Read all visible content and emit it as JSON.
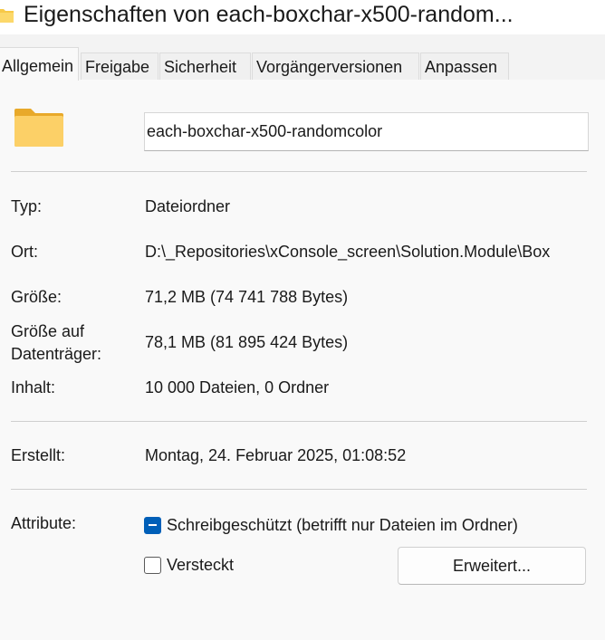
{
  "window": {
    "title": "Eigenschaften von each-boxchar-x500-random..."
  },
  "tabs": [
    {
      "label": "Allgemein",
      "active": true
    },
    {
      "label": "Freigabe",
      "active": false
    },
    {
      "label": "Sicherheit",
      "active": false
    },
    {
      "label": "Vorgängerversionen",
      "active": false
    },
    {
      "label": "Anpassen",
      "active": false
    }
  ],
  "header": {
    "folder_icon": "folder-icon",
    "folder_icon_color": "#f7c948",
    "name_value": "each-boxchar-x500-randomcolor"
  },
  "properties": {
    "type_label": "Typ:",
    "type_value": "Dateiordner",
    "location_label": "Ort:",
    "location_value": "D:\\_Repositories\\xConsole_screen\\Solution.Module\\Box",
    "size_label": "Größe:",
    "size_value": "71,2 MB (74 741 788 Bytes)",
    "size_on_disk_label_line1": "Größe auf",
    "size_on_disk_label_line2": "Datenträger:",
    "size_on_disk_value": "78,1 MB (81 895 424 Bytes)",
    "contents_label": "Inhalt:",
    "contents_value": "10 000 Dateien, 0 Ordner",
    "created_label": "Erstellt:",
    "created_value": "Montag, 24. Februar 2025, 01:08:52"
  },
  "attributes": {
    "label": "Attribute:",
    "readonly_label": "Schreibgeschützt (betrifft nur Dateien im Ordner)",
    "readonly_state": "indeterminate",
    "hidden_label": "Versteckt",
    "hidden_state": "unchecked",
    "advanced_button": "Erweitert...",
    "accent_color": "#005fb8"
  }
}
